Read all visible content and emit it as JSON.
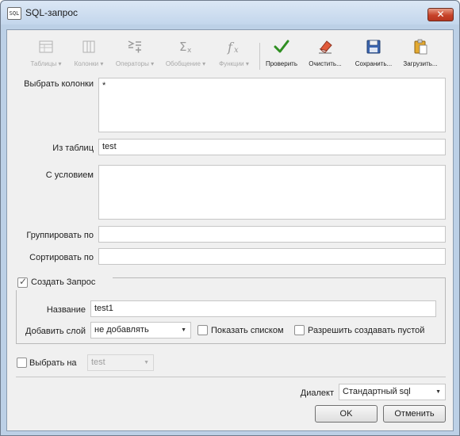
{
  "window": {
    "title": "SQL-запрос",
    "icon_text": "SQL",
    "close_symbol": "✕"
  },
  "toolbar": {
    "tables": "Таблицы",
    "columns": "Колонки",
    "operators": "Операторы",
    "aggregates": "Обобщение",
    "functions": "Функции",
    "check": "Проверить",
    "clear": "Очистить...",
    "save": "Сохранить...",
    "load": "Загрузить...",
    "dropdown_marker": "▾"
  },
  "form": {
    "select_columns_label": "Выбрать колонки",
    "select_columns_value": "*",
    "from_tables_label": "Из таблиц",
    "from_tables_value": "test",
    "where_label": "С условием",
    "where_value": "",
    "group_by_label": "Группировать по",
    "group_by_value": "",
    "order_by_label": "Сортировать по",
    "order_by_value": ""
  },
  "create_query": {
    "label": "Создать Запрос",
    "checked": true,
    "name_label": "Название",
    "name_value": "test1",
    "add_layer_label": "Добавить слой",
    "add_layer_value": "не добавлять",
    "show_as_list_label": "Показать списком",
    "allow_empty_label": "Разрешить создавать пустой"
  },
  "select_on": {
    "label": "Выбрать на",
    "value": "test"
  },
  "dialect": {
    "label": "Диалект",
    "value": "Стандартный sql"
  },
  "buttons": {
    "ok": "OK",
    "cancel": "Отменить"
  },
  "colors": {
    "check_green": "#2f8f22",
    "close_red": "#c7432a"
  }
}
